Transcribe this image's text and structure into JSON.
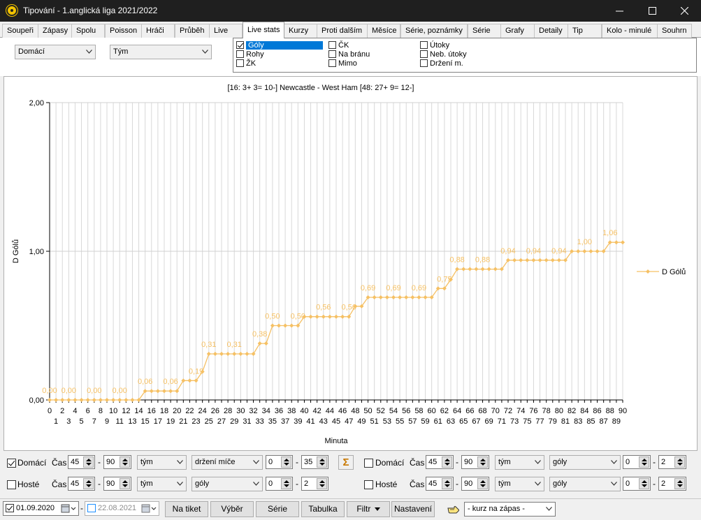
{
  "window": {
    "title": "Tipování - 1.anglická liga 2021/2022"
  },
  "tabs": [
    {
      "label": "Soupeři"
    },
    {
      "label": "Zápasy"
    },
    {
      "label": "Spolu"
    },
    {
      "label": "Poisson"
    },
    {
      "label": "Hráči"
    },
    {
      "label": "Průběh"
    },
    {
      "label": "Live"
    },
    {
      "label": "Live stats",
      "active": true
    },
    {
      "label": "Kurzy"
    },
    {
      "label": "Proti dalším"
    },
    {
      "label": "Měsíce"
    },
    {
      "label": "Série, poznámky"
    },
    {
      "label": "Série"
    },
    {
      "label": "Grafy"
    },
    {
      "label": "Detaily"
    },
    {
      "label": "Tip"
    },
    {
      "label": "Kolo - minulé"
    },
    {
      "label": "Souhrn"
    }
  ],
  "filters": {
    "side": "Domácí",
    "group": "Tým"
  },
  "stats_checks": [
    {
      "label": "Góly",
      "checked": true,
      "selected": true
    },
    {
      "label": "Rohy",
      "checked": false
    },
    {
      "label": "ŽK",
      "checked": false
    },
    {
      "label": "ČK",
      "checked": false
    },
    {
      "label": "Na bránu",
      "checked": false
    },
    {
      "label": "Mimo",
      "checked": false
    },
    {
      "label": "Útoky",
      "checked": false
    },
    {
      "label": "Neb. útoky",
      "checked": false
    },
    {
      "label": "Držení m.",
      "checked": false
    }
  ],
  "chart_data": {
    "type": "line",
    "title": "[16:  3+  3=  10-] Newcastle - West Ham [48:  27+  9=  12-]",
    "xlabel": "Minuta",
    "ylabel": "D Gólů",
    "ylim": [
      0,
      2
    ],
    "yticks": [
      "0,00",
      "1,00",
      "2,00"
    ],
    "xlim": [
      0,
      90
    ],
    "grid": true,
    "legend_position": "right",
    "color": "#f5c064",
    "series": [
      {
        "name": "D Gólů",
        "x": [
          0,
          1,
          2,
          3,
          4,
          5,
          6,
          7,
          8,
          9,
          10,
          11,
          12,
          13,
          14,
          15,
          16,
          17,
          18,
          19,
          20,
          21,
          22,
          23,
          24,
          25,
          26,
          27,
          28,
          29,
          30,
          31,
          32,
          33,
          34,
          35,
          36,
          37,
          38,
          39,
          40,
          41,
          42,
          43,
          44,
          45,
          46,
          47,
          48,
          49,
          50,
          51,
          52,
          53,
          54,
          55,
          56,
          57,
          58,
          59,
          60,
          61,
          62,
          63,
          64,
          65,
          66,
          67,
          68,
          69,
          70,
          71,
          72,
          73,
          74,
          75,
          76,
          77,
          78,
          79,
          80,
          81,
          82,
          83,
          84,
          85,
          86,
          87,
          88,
          89,
          90
        ],
        "values": [
          0,
          0,
          0,
          0,
          0,
          0,
          0,
          0,
          0,
          0,
          0,
          0,
          0,
          0,
          0,
          0.06,
          0.06,
          0.06,
          0.06,
          0.06,
          0.06,
          0.13,
          0.13,
          0.13,
          0.19,
          0.31,
          0.31,
          0.31,
          0.31,
          0.31,
          0.31,
          0.31,
          0.31,
          0.38,
          0.38,
          0.5,
          0.5,
          0.5,
          0.5,
          0.5,
          0.56,
          0.56,
          0.56,
          0.56,
          0.56,
          0.56,
          0.56,
          0.56,
          0.63,
          0.63,
          0.69,
          0.69,
          0.69,
          0.69,
          0.69,
          0.69,
          0.69,
          0.69,
          0.69,
          0.69,
          0.69,
          0.75,
          0.75,
          0.81,
          0.88,
          0.88,
          0.88,
          0.88,
          0.88,
          0.88,
          0.88,
          0.88,
          0.94,
          0.94,
          0.94,
          0.94,
          0.94,
          0.94,
          0.94,
          0.94,
          0.94,
          0.94,
          1,
          1,
          1,
          1,
          1,
          1,
          1.06,
          1.06,
          1.06
        ]
      }
    ],
    "point_labels": [
      {
        "x": 0,
        "text": "0,00"
      },
      {
        "x": 3,
        "text": "0,00"
      },
      {
        "x": 7,
        "text": "0,00"
      },
      {
        "x": 11,
        "text": "0,00"
      },
      {
        "x": 15,
        "text": "0,06"
      },
      {
        "x": 19,
        "text": "0,06"
      },
      {
        "x": 23,
        "text": "0,19"
      },
      {
        "x": 25,
        "text": "0,31"
      },
      {
        "x": 29,
        "text": "0,31"
      },
      {
        "x": 33,
        "text": "0,38"
      },
      {
        "x": 35,
        "text": "0,50"
      },
      {
        "x": 39,
        "text": "0,50"
      },
      {
        "x": 43,
        "text": "0,56"
      },
      {
        "x": 47,
        "text": "0,56"
      },
      {
        "x": 50,
        "text": "0,69"
      },
      {
        "x": 54,
        "text": "0,69"
      },
      {
        "x": 58,
        "text": "0,69"
      },
      {
        "x": 62,
        "text": "0,75"
      },
      {
        "x": 64,
        "text": "0,88"
      },
      {
        "x": 68,
        "text": "0,88"
      },
      {
        "x": 72,
        "text": "0,94"
      },
      {
        "x": 76,
        "text": "0,94"
      },
      {
        "x": 80,
        "text": "0,94"
      },
      {
        "x": 84,
        "text": "1,00"
      },
      {
        "x": 88,
        "text": "1,06"
      }
    ]
  },
  "controls": {
    "left": [
      {
        "label": "Domácí",
        "checked": true,
        "cas_label": "Čas",
        "from": "45",
        "to": "90",
        "grp": "tým",
        "stat": "držení míče",
        "min": "0",
        "max": "35"
      },
      {
        "label": "Hosté",
        "checked": false,
        "cas_label": "Čas",
        "from": "45",
        "to": "90",
        "grp": "tým",
        "stat": "góly",
        "min": "0",
        "max": "2"
      }
    ],
    "right": [
      {
        "label": "Domácí",
        "checked": false,
        "cas_label": "Čas",
        "from": "45",
        "to": "90",
        "grp": "tým",
        "stat": "góly",
        "min": "0",
        "max": "2"
      },
      {
        "label": "Hosté",
        "checked": false,
        "cas_label": "Čas",
        "from": "45",
        "to": "90",
        "grp": "tým",
        "stat": "góly",
        "min": "0",
        "max": "2"
      }
    ]
  },
  "statusbar": {
    "date_from": "01.09.2020",
    "date_to": "22.08.2021",
    "btn_ticket": "Na tiket",
    "btn_select": "Výběr",
    "btn_series": "Série",
    "btn_table": "Tabulka",
    "btn_filter": "Filtr",
    "btn_settings": "Nastavení",
    "odds_combo": "- kurz na zápas -"
  },
  "colors": {
    "titlebar": "#1f1f1f",
    "selection": "#0078d7",
    "series": "#f5c064"
  }
}
